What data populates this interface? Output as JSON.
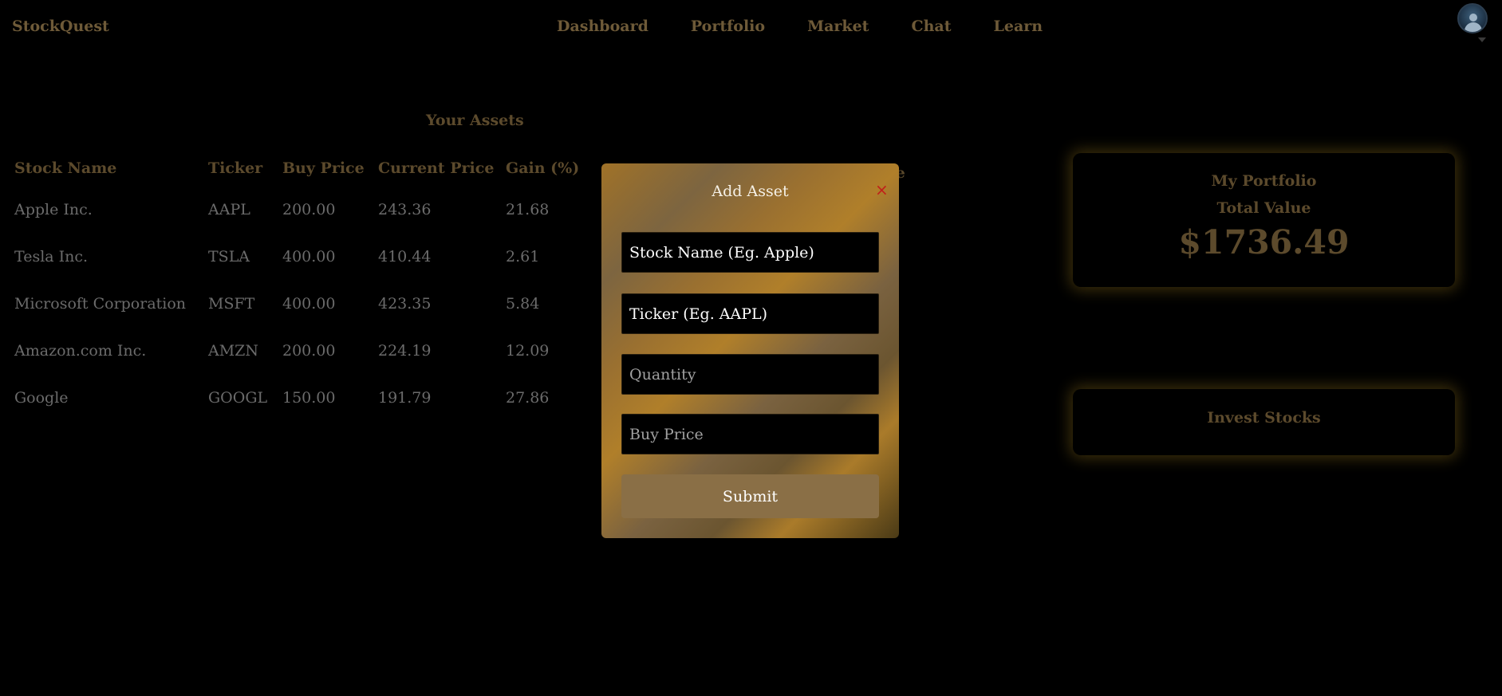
{
  "app": {
    "brand": "StockQuest"
  },
  "nav": {
    "items": [
      "Dashboard",
      "Portfolio",
      "Market",
      "Chat",
      "Learn"
    ]
  },
  "assets": {
    "title": "Your Assets",
    "columns": [
      "Stock Name",
      "Ticker",
      "Buy Price",
      "Current Price",
      "Gain (%)"
    ],
    "header_tail": "ze",
    "rows": [
      {
        "name": "Apple Inc.",
        "ticker": "AAPL",
        "buy": "200.00",
        "current": "243.36",
        "gain": "21.68"
      },
      {
        "name": "Tesla Inc.",
        "ticker": "TSLA",
        "buy": "400.00",
        "current": "410.44",
        "gain": "2.61"
      },
      {
        "name": "Microsoft Corporation",
        "ticker": "MSFT",
        "buy": "400.00",
        "current": "423.35",
        "gain": "5.84"
      },
      {
        "name": "Amazon.com Inc.",
        "ticker": "AMZN",
        "buy": "200.00",
        "current": "224.19",
        "gain": "12.09"
      },
      {
        "name": "Google",
        "ticker": "GOOGL",
        "buy": "150.00",
        "current": "191.79",
        "gain": "27.86"
      }
    ]
  },
  "portfolio": {
    "title": "My Portfolio",
    "total_label": "Total Value",
    "total_value": "$1736.49"
  },
  "invest": {
    "label": "Invest Stocks"
  },
  "modal": {
    "title": "Add Asset",
    "close_glyph": "×",
    "stock_name_placeholder": "Stock Name (Eg. Apple)",
    "ticker_placeholder": "Ticker (Eg. AAPL)",
    "quantity_placeholder": "Quantity",
    "buy_price_placeholder": "Buy Price",
    "submit_label": "Submit"
  },
  "icons": {
    "avatar": "user-avatar-icon",
    "caret": "caret-down-icon",
    "close": "close-icon"
  },
  "colors": {
    "accent": "#6e5a38",
    "modal_gold": "#a07228",
    "close_red": "#c0201a"
  }
}
